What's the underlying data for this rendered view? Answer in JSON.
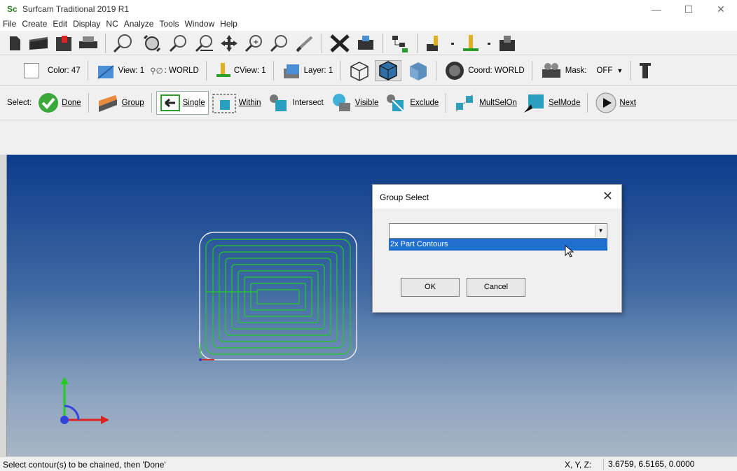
{
  "window": {
    "logo": "Sc",
    "title": "Surfcam Traditional 2019 R1",
    "minimize": "—",
    "maximize": "☐",
    "close": "✕"
  },
  "menu": [
    "File",
    "Create",
    "Edit",
    "Display",
    "NC",
    "Analyze",
    "Tools",
    "Window",
    "Help"
  ],
  "toolbar2": {
    "color_label": "Color: 47",
    "view_label": "View: 1",
    "coordsys_label": ": WORLD",
    "cview_label": "CView: 1",
    "layer_label": "Layer: 1",
    "coord_label": "Coord: WORLD",
    "mask_label": "Mask:",
    "mask_value": "OFF"
  },
  "toolbar3": {
    "select_label": "Select:",
    "done": "Done",
    "group": "Group",
    "single": "Single",
    "within": "Within",
    "intersect": "Intersect",
    "visible": "Visible",
    "exclude": "Exclude",
    "multselon": "MultSelOn",
    "selmode": "SelMode",
    "next": "Next"
  },
  "dialog": {
    "title": "Group Select",
    "close": "✕",
    "combo_value": "",
    "dropdown_arrow": "▼",
    "list_item": "2x Part Contours",
    "ok": "OK",
    "cancel": "Cancel"
  },
  "status": {
    "message": "Select contour(s) to be chained, then 'Done'",
    "coord_label": "X, Y, Z:",
    "coord_value": "3.6759, 6.5165, 0.0000"
  },
  "colors": {
    "accent": "#1e6fd0",
    "contour": "#22cc22",
    "viewport_top": "#0d3b8c",
    "viewport_bottom": "#a9b5c5"
  }
}
